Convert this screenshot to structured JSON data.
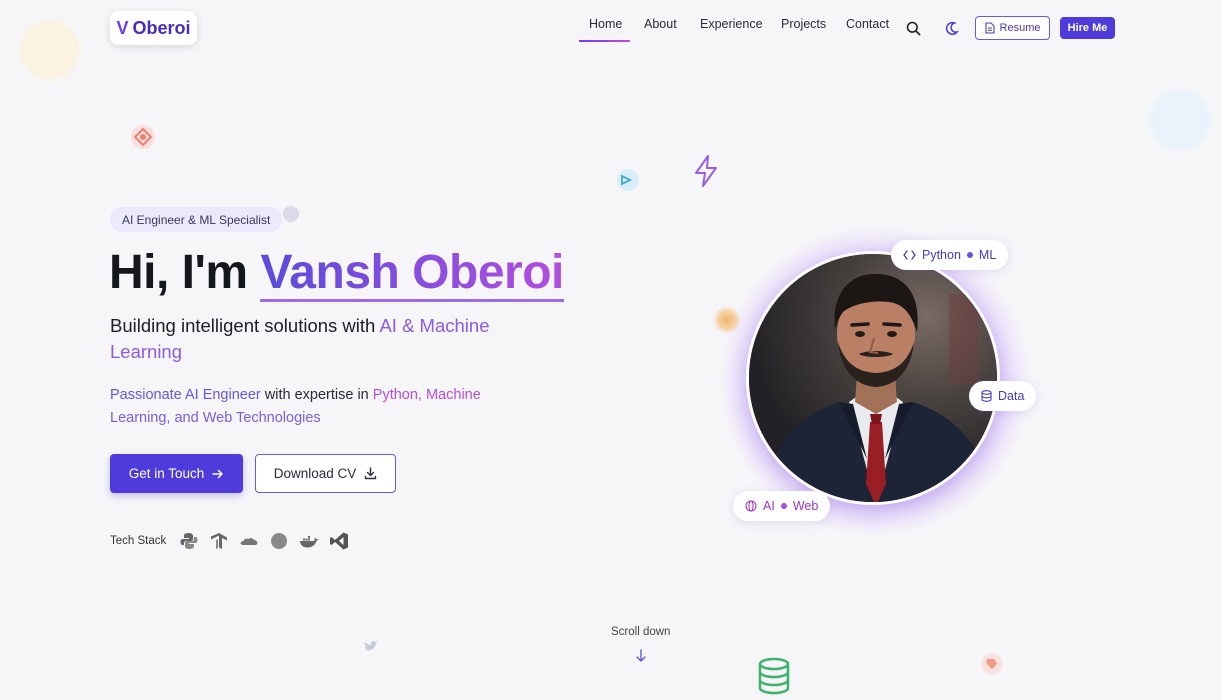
{
  "header": {
    "logo": {
      "mark": "V",
      "name": "Oberoi"
    },
    "nav": [
      {
        "label": "Home",
        "active": true
      },
      {
        "label": "About",
        "active": false
      },
      {
        "label": "Experience",
        "active": false
      },
      {
        "label": "Projects",
        "active": false
      },
      {
        "label": "Contact",
        "active": false
      }
    ],
    "icons": {
      "search": "search-icon",
      "theme": "moon-icon"
    },
    "resume_label": "Resume",
    "hire_label": "Hire Me"
  },
  "hero": {
    "badge": "AI Engineer & ML Specialist",
    "title_prefix": "Hi, I'm ",
    "title_name": "Vansh Oberoi",
    "subtitle_prefix": "Building intelligent solutions with ",
    "subtitle_highlight": "AI & Machine Learning",
    "desc_part1": "Passionate AI Engineer",
    "desc_part2": " with expertise in ",
    "desc_part3": "Python, Machine",
    "desc_part4": "Learning, and Web Technologies",
    "cta_primary": "Get in Touch",
    "cta_secondary": "Download CV",
    "tech_label": "Tech Stack",
    "tech_icons": [
      "python-icon",
      "tensorflow-icon",
      "cloud-icon",
      "circle-icon",
      "docker-icon",
      "vscode-icon"
    ]
  },
  "profile": {
    "chips": [
      {
        "a": "Python",
        "b": "ML"
      },
      {
        "a": "Data"
      },
      {
        "a": "AI",
        "b": "Web"
      }
    ]
  },
  "scroll_label": "Scroll down",
  "colors": {
    "accent": "#4f3bdc",
    "gradient_start": "#5a4bdc",
    "gradient_end": "#b34fe0",
    "background": "#f6f6f9"
  }
}
